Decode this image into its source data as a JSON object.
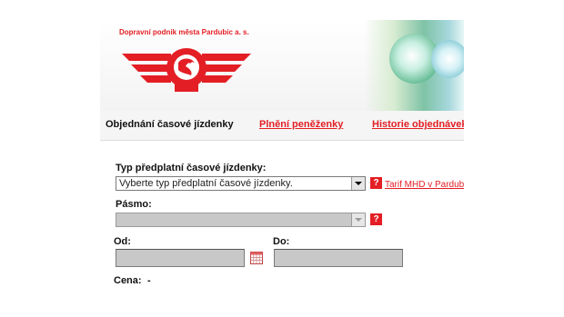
{
  "header": {
    "company_name": "Dopravní podnik města Pardubic a. s.",
    "logo_icon": "dpmp-logo-icon",
    "brand_red": "#e31e24"
  },
  "nav": {
    "items": [
      {
        "label": "Objednání časové jízdenky",
        "active": true
      },
      {
        "label": "Plnění peněženky",
        "active": false
      },
      {
        "label": "Historie objednávek",
        "active": false
      }
    ]
  },
  "form": {
    "type": {
      "label": "Typ předplatní časové jízdenky:",
      "selected": "Vyberte typ předplatní časové jízdenky.",
      "help_glyph": "?",
      "tariff_link": "Tarif MHD v Pardubicích"
    },
    "zone": {
      "label": "Pásmo:",
      "selected": "",
      "help_glyph": "?"
    },
    "from": {
      "label": "Od:",
      "value": "",
      "icon": "calendar-icon"
    },
    "to": {
      "label": "Do:",
      "value": ""
    },
    "price": {
      "label": "Cena:",
      "value": "-"
    }
  }
}
